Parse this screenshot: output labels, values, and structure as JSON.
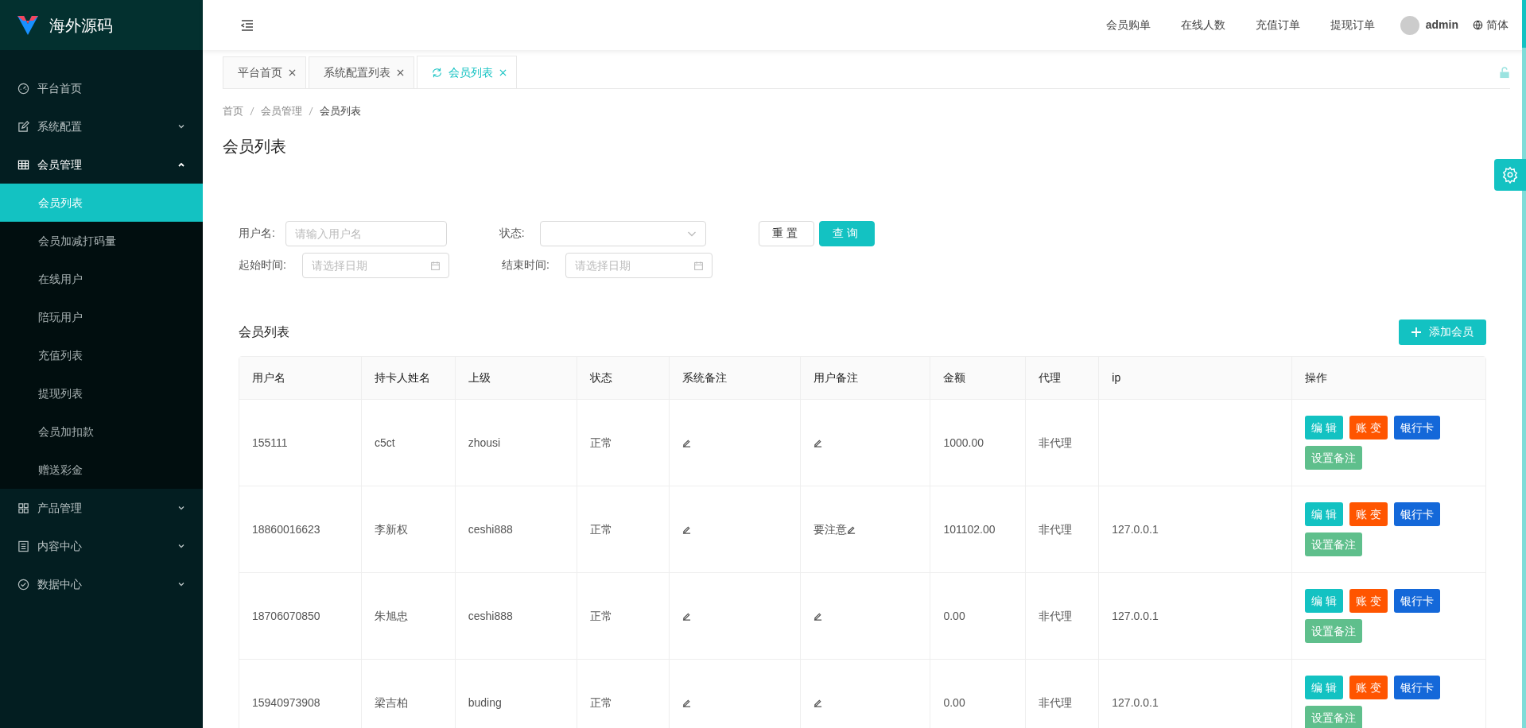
{
  "brand": {
    "title": "海外源码"
  },
  "sidebar": {
    "items": [
      {
        "label": "平台首页"
      },
      {
        "label": "系统配置",
        "expanded": false
      },
      {
        "label": "会员管理",
        "expanded": true,
        "children": [
          {
            "label": "会员列表",
            "selected": true
          },
          {
            "label": "会员加减打码量",
            "selected": false
          },
          {
            "label": "在线用户",
            "selected": false
          },
          {
            "label": "陪玩用户",
            "selected": false
          },
          {
            "label": "充值列表",
            "selected": false
          },
          {
            "label": "提现列表",
            "selected": false
          },
          {
            "label": "会员加扣款",
            "selected": false
          },
          {
            "label": "赠送彩金",
            "selected": false
          }
        ]
      },
      {
        "label": "产品管理",
        "expanded": false
      },
      {
        "label": "内容中心",
        "expanded": false
      },
      {
        "label": "数据中心",
        "expanded": false
      }
    ]
  },
  "header": {
    "links": [
      "会员购单",
      "在线人数",
      "充值订单",
      "提现订单"
    ],
    "user": "admin",
    "language": "简体"
  },
  "tabs": [
    {
      "label": "平台首页",
      "selected": false
    },
    {
      "label": "系统配置列表",
      "selected": false
    },
    {
      "label": "会员列表",
      "selected": true
    }
  ],
  "breadcrumb": [
    "首页",
    "会员管理",
    "会员列表"
  ],
  "page_title": "会员列表",
  "filters": {
    "username": {
      "label": "用户名:",
      "placeholder": "请输入用户名"
    },
    "status": {
      "label": "状态:"
    },
    "start": {
      "label": "起始时间:",
      "placeholder": "请选择日期"
    },
    "end": {
      "label": "结束时间:",
      "placeholder": "请选择日期"
    },
    "reset": "重置",
    "query": "查询"
  },
  "list_title": "会员列表",
  "add_button": "添加会员",
  "table": {
    "columns": [
      "用户名",
      "持卡人姓名",
      "上级",
      "状态",
      "系统备注",
      "用户备注",
      "金额",
      "代理",
      "ip",
      "操作"
    ],
    "rows": [
      {
        "username": "155111",
        "holder": "c5ct",
        "parent": "zhousi",
        "status": "正常",
        "amount": "1000.00",
        "agent": "非代理",
        "actions": [
          {
            "label": "编 辑",
            "kind": "edit"
          },
          {
            "label": "账 变",
            "kind": "ledger"
          },
          {
            "label": "银行卡",
            "kind": "bank"
          },
          {
            "label": "设置备注",
            "kind": "note"
          }
        ]
      },
      {
        "username": "18860016623",
        "holder": "李新权",
        "parent": "ceshi888",
        "status": "正常",
        "user_note": "要注意",
        "amount": "101102.00",
        "agent": "非代理",
        "ip": "127.0.0.1",
        "actions": [
          {
            "label": "编 辑",
            "kind": "edit"
          },
          {
            "label": "账 变",
            "kind": "ledger"
          },
          {
            "label": "银行卡",
            "kind": "bank"
          },
          {
            "label": "设置备注",
            "kind": "note"
          }
        ]
      },
      {
        "username": "18706070850",
        "holder": "朱旭忠",
        "parent": "ceshi888",
        "status": "正常",
        "amount": "0.00",
        "agent": "非代理",
        "ip": "127.0.0.1",
        "actions": [
          {
            "label": "编 辑",
            "kind": "edit"
          },
          {
            "label": "账 变",
            "kind": "ledger"
          },
          {
            "label": "银行卡",
            "kind": "bank"
          },
          {
            "label": "设置备注",
            "kind": "note"
          }
        ]
      },
      {
        "username": "15940973908",
        "holder": "梁吉柏",
        "parent": "buding",
        "status": "正常",
        "amount": "0.00",
        "agent": "非代理",
        "ip": "127.0.0.1",
        "actions": [
          {
            "label": "编 辑",
            "kind": "edit"
          },
          {
            "label": "账 变",
            "kind": "ledger"
          },
          {
            "label": "银行卡",
            "kind": "bank"
          },
          {
            "label": "设置备注",
            "kind": "note"
          }
        ]
      }
    ]
  }
}
